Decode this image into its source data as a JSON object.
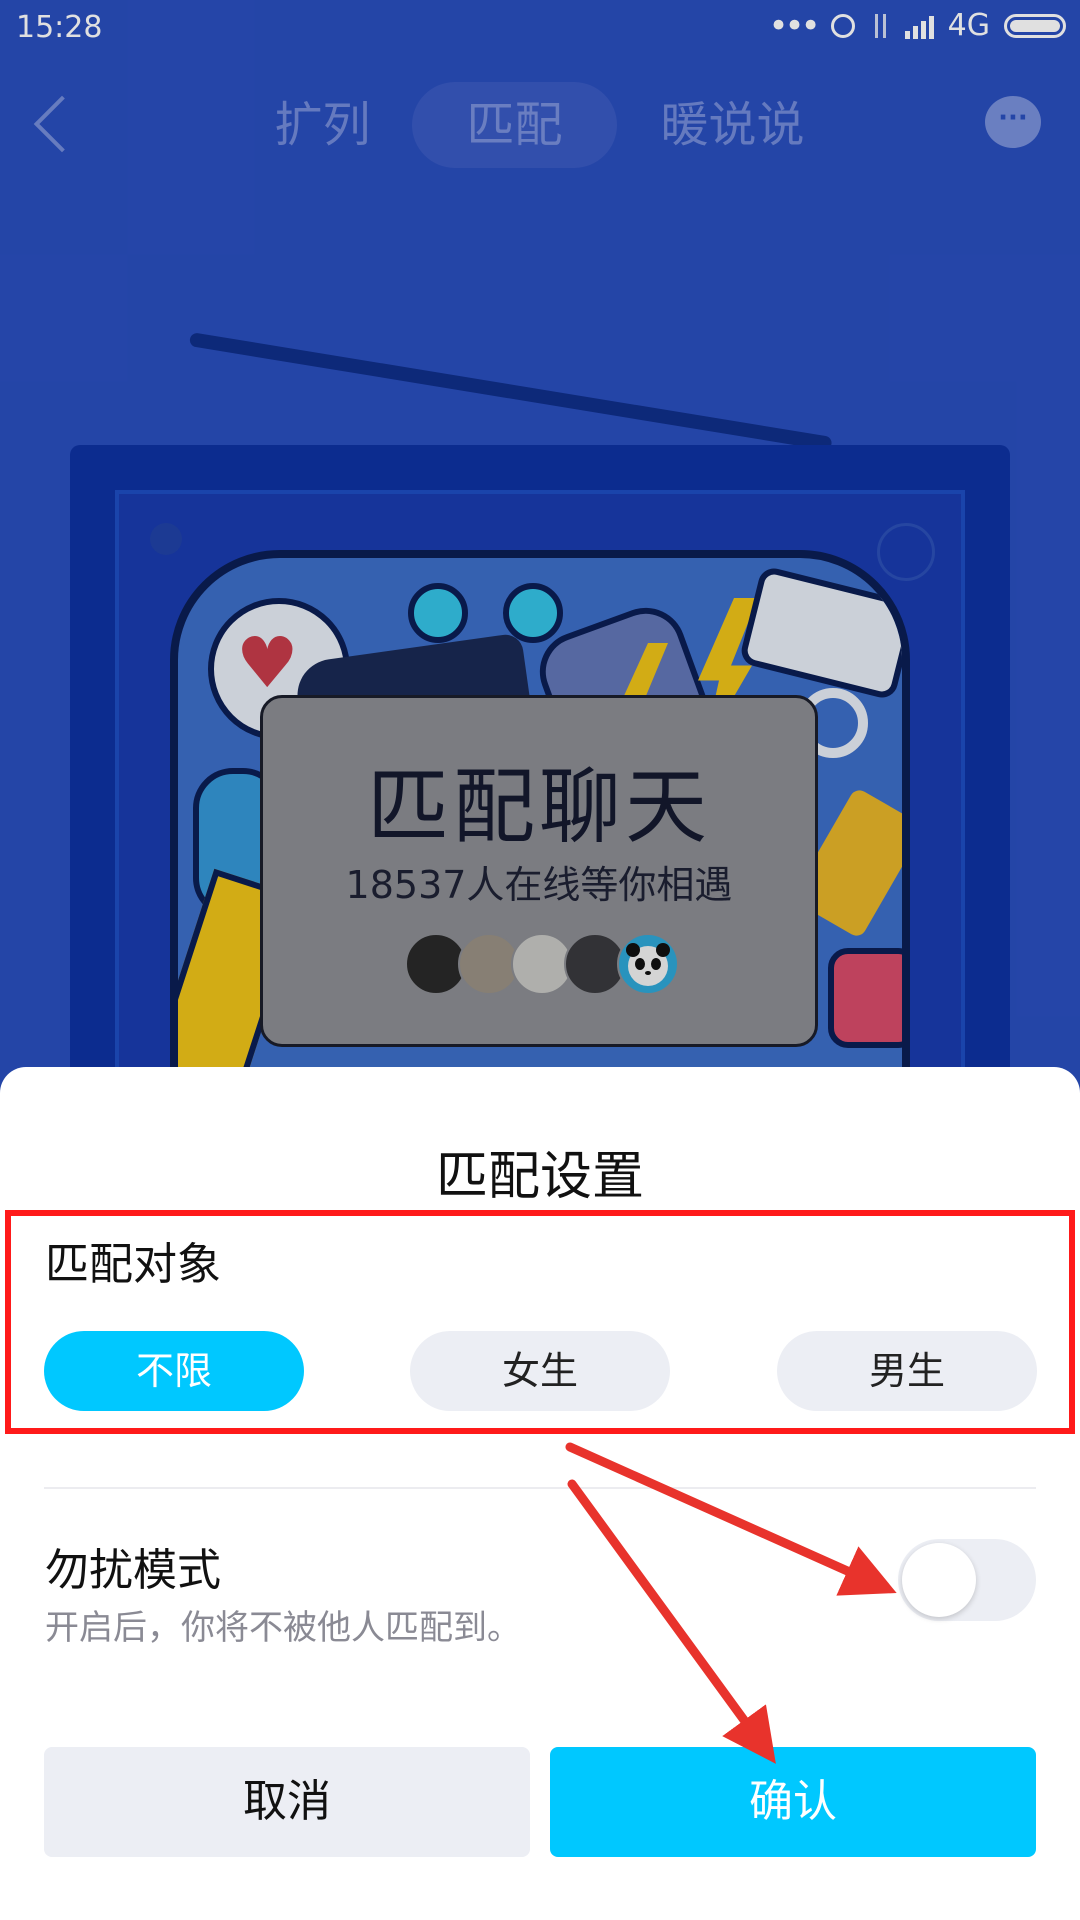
{
  "status_bar": {
    "time": "15:28",
    "network": "4G"
  },
  "nav": {
    "tabs": [
      {
        "label": "扩列",
        "active": false
      },
      {
        "label": "匹配",
        "active": true
      },
      {
        "label": "暖说说",
        "active": false
      }
    ],
    "back_icon": "chevron-left-icon",
    "message_icon": "chat-bubble-icon"
  },
  "match_card": {
    "title": "匹配聊天",
    "subtitle": "18537人在线等你相遇",
    "avatar_count": 5
  },
  "sheet": {
    "title": "匹配设置",
    "target_label": "匹配对象",
    "options": [
      {
        "label": "不限",
        "selected": true
      },
      {
        "label": "女生",
        "selected": false
      },
      {
        "label": "男生",
        "selected": false
      }
    ],
    "dnd_label": "勿扰模式",
    "dnd_description": "开启后，你将不被他人匹配到。",
    "dnd_enabled": false,
    "cancel_label": "取消",
    "confirm_label": "确认"
  },
  "colors": {
    "accent": "#00c8ff",
    "background": "#2a4fbf",
    "annotation": "#ff1a1a"
  }
}
